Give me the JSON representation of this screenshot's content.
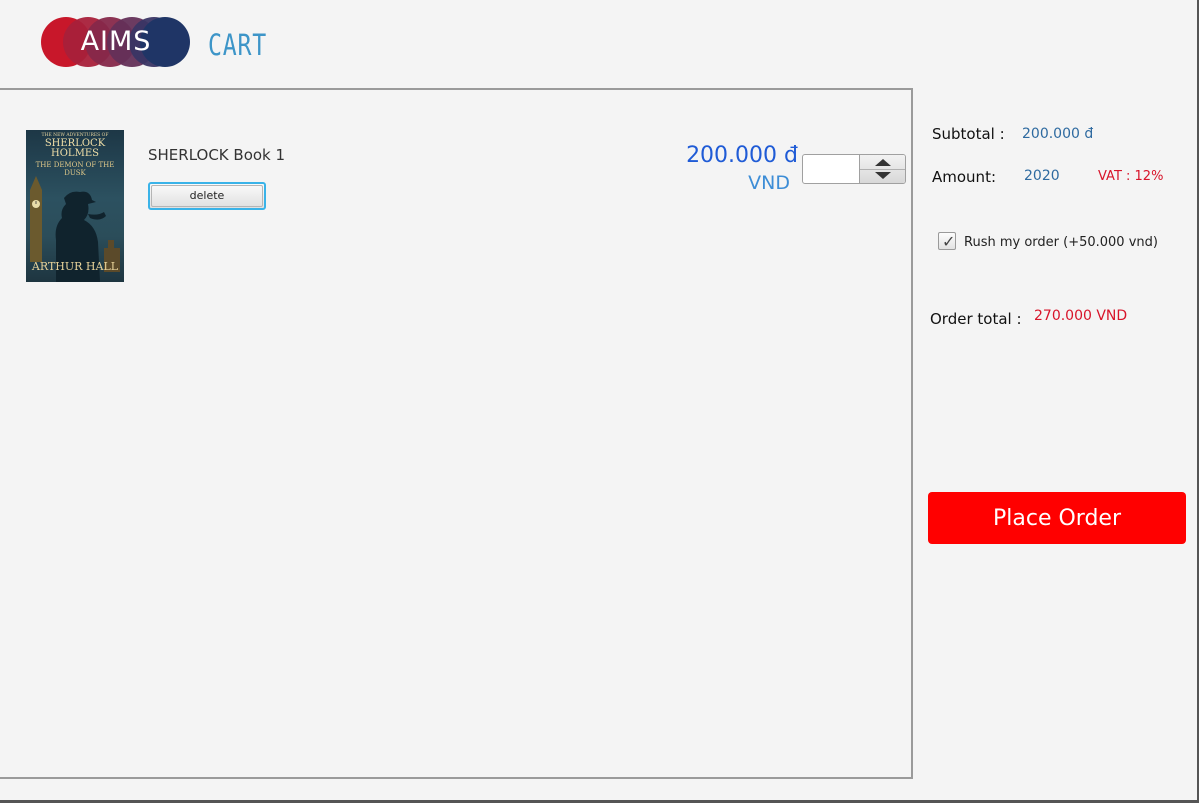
{
  "header": {
    "logo_text": "AIMS",
    "title": "CART"
  },
  "cart": {
    "items": [
      {
        "cover": {
          "top_line": "THE NEW ADVENTURES OF",
          "series": "SHERLOCK HOLMES",
          "subtitle": "THE DEMON OF THE DUSK",
          "author": "ARTHUR HALL"
        },
        "title": "SHERLOCK Book 1",
        "delete_label": "delete",
        "price": "200.000 đ",
        "currency": "VND",
        "quantity": ""
      }
    ]
  },
  "summary": {
    "subtotal_label": "Subtotal :",
    "subtotal_value": "200.000 đ",
    "amount_label": "Amount:",
    "amount_value": "2020",
    "vat": "VAT : 12%",
    "rush_label": "Rush my order (+50.000 vnd)",
    "rush_checked": true,
    "order_total_label": "Order total :",
    "order_total_value": "270.000 VND",
    "place_order_label": "Place Order"
  },
  "colors": {
    "accent_blue": "#3d95c8",
    "price_blue": "#1f5bd6",
    "alert_red": "#d8142a",
    "button_red": "#ff0000"
  }
}
